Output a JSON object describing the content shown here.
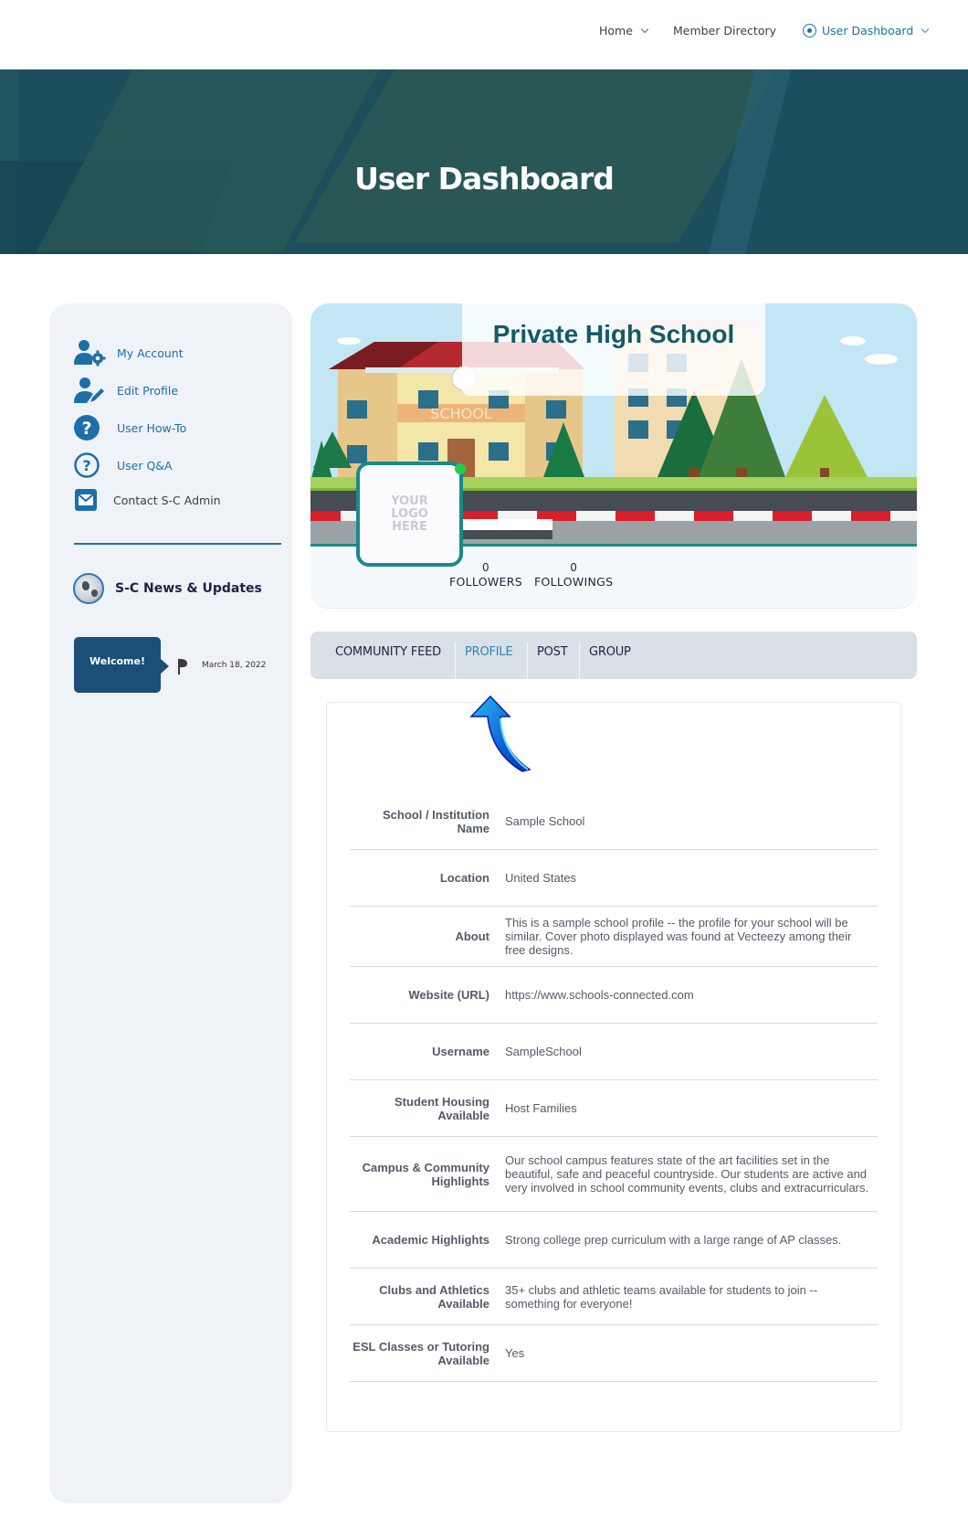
{
  "nav": {
    "items": [
      {
        "label": "Home",
        "has_dropdown": true,
        "active": false
      },
      {
        "label": "Member Directory",
        "has_dropdown": false,
        "active": false
      },
      {
        "label": "User Dashboard",
        "has_dropdown": true,
        "active": true,
        "icon": "radio-dot-icon"
      }
    ]
  },
  "hero": {
    "title": "User Dashboard"
  },
  "sidebar": {
    "links": [
      {
        "label": "My Account",
        "icon": "user-gear-icon"
      },
      {
        "label": "Edit Profile",
        "icon": "user-edit-icon"
      },
      {
        "label": "User How-To",
        "icon": "question-circle-filled-icon"
      },
      {
        "label": "User Q&A",
        "icon": "question-circle-outline-icon"
      },
      {
        "label": "Contact S-C Admin",
        "icon": "envelope-icon"
      }
    ],
    "news": {
      "title": "S-C News & Updates",
      "icon": "globe-icon",
      "posts": [
        {
          "title": "Welcome!",
          "date": "March 18, 2022",
          "icon": "flag-icon"
        }
      ]
    }
  },
  "profile_header": {
    "school_name": "Private High School",
    "logo_placeholder": "YOUR LOGO HERE",
    "online": true,
    "cover_sign_text": "SCHOOL",
    "stats": [
      {
        "value": "0",
        "label": "FOLLOWERS"
      },
      {
        "value": "0",
        "label": "FOLLOWINGS"
      }
    ],
    "colors": {
      "accent": "#1a8a8a",
      "title": "#125a68",
      "online": "#1fd04f"
    }
  },
  "tabs": [
    {
      "label": "COMMUNITY FEED",
      "active": false
    },
    {
      "label": "PROFILE",
      "active": true
    },
    {
      "label": "POST",
      "active": false
    },
    {
      "label": "GROUP",
      "active": false
    }
  ],
  "annotation": {
    "icon": "curved-arrow-up-icon",
    "points_to": "PROFILE"
  },
  "profile_fields": [
    {
      "label": "School / Institution Name",
      "value": "Sample School"
    },
    {
      "label": "Location",
      "value": "United States"
    },
    {
      "label": "About",
      "value": "This is a sample school profile -- the profile for your school will be similar. Cover photo displayed was found at Vecteezy among their free designs."
    },
    {
      "label": "Website (URL)",
      "value": "https://www.schools-connected.com"
    },
    {
      "label": "Username",
      "value": "SampleSchool"
    },
    {
      "label": "Student Housing Available",
      "value": "Host Families"
    },
    {
      "label": "Campus & Community Highlights",
      "value": "Our school campus features state of the art facilities set in the beautiful, safe and peaceful countryside. Our students are active and very involved in school community events, clubs and extracurriculars."
    },
    {
      "label": "Academic Highlights",
      "value": "Strong college prep curriculum with a large range of AP classes."
    },
    {
      "label": "Clubs and Athletics Available",
      "value": "35+ clubs and athletic teams available for students to join -- something for everyone!"
    },
    {
      "label": "ESL Classes or Tutoring Available",
      "value": "Yes"
    }
  ]
}
